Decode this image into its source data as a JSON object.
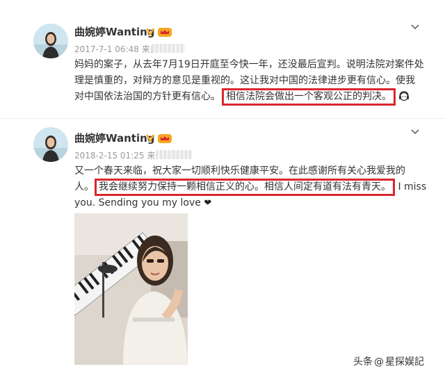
{
  "posts": [
    {
      "author": "曲婉婷Wanting",
      "date": "2017-7-1 06:48",
      "source_prefix": "来自",
      "lines": [
        "妈妈的案子，从去年7月19日开庭至今快一年，还没最后宣判。说明法院对案件处",
        "理是慎重的，对辩方的意见是重视的。这让我对中国的法律进步更有信心。使我"
      ],
      "line3_before": "对中国依法治国的方针更有信心。",
      "highlight": "相信法院会做出一个客观公正的判决。",
      "icon": "headphones-face-emoji-icon"
    },
    {
      "author": "曲婉婷Wanting",
      "date": "2018-2-15 01:25",
      "source_prefix": "来自",
      "line1": "又一个春天来临，祝大家一切顺利快乐健康平安。在此感谢所有关心我爱我的",
      "line2_before": "人。",
      "highlight": "我会继续努力保持一颗相信正义的心。相信人间定有道有法有青天。",
      "line2_after": "I miss",
      "line3": "you. Sending you my love",
      "heart": "❤",
      "photo_icon": "selfie-with-keyboard-photo"
    }
  ],
  "watermark": {
    "prefix": "头条",
    "separator": "@",
    "account": "星探娱記"
  },
  "colors": {
    "highlight_border": "#d9272d",
    "badge_gold": "#f5a623",
    "meta_gray": "#999999"
  }
}
